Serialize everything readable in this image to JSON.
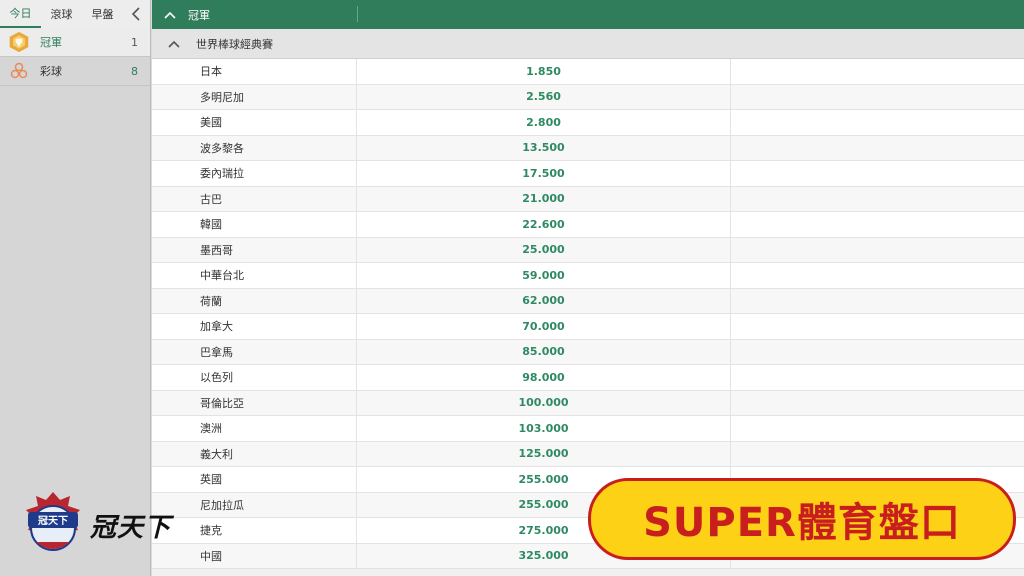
{
  "sidebar": {
    "tabs": [
      {
        "label": "今日"
      },
      {
        "label": "滾球"
      },
      {
        "label": "早盤"
      }
    ],
    "collapse_icon": "chevron-left-icon",
    "items": [
      {
        "label": "冠軍",
        "count": "1",
        "icon": "trophy-icon"
      },
      {
        "label": "彩球",
        "count": "8",
        "icon": "lottery-balls-icon"
      }
    ]
  },
  "header": {
    "title": "冠軍",
    "collapse_icon": "chevron-up-icon"
  },
  "league": {
    "name": "世界棒球經典賽"
  },
  "rows": [
    {
      "team": "日本",
      "odds": "1.850"
    },
    {
      "team": "多明尼加",
      "odds": "2.560"
    },
    {
      "team": "美國",
      "odds": "2.800"
    },
    {
      "team": "波多黎各",
      "odds": "13.500"
    },
    {
      "team": "委內瑞拉",
      "odds": "17.500"
    },
    {
      "team": "古巴",
      "odds": "21.000"
    },
    {
      "team": "韓國",
      "odds": "22.600"
    },
    {
      "team": "墨西哥",
      "odds": "25.000"
    },
    {
      "team": "中華台北",
      "odds": "59.000"
    },
    {
      "team": "荷蘭",
      "odds": "62.000"
    },
    {
      "team": "加拿大",
      "odds": "70.000"
    },
    {
      "team": "巴拿馬",
      "odds": "85.000"
    },
    {
      "team": "以色列",
      "odds": "98.000"
    },
    {
      "team": "哥倫比亞",
      "odds": "100.000"
    },
    {
      "team": "澳洲",
      "odds": "103.000"
    },
    {
      "team": "義大利",
      "odds": "125.000"
    },
    {
      "team": "英國",
      "odds": "255.000"
    },
    {
      "team": "尼加拉瓜",
      "odds": "255.000"
    },
    {
      "team": "捷克",
      "odds": "275.000"
    },
    {
      "team": "中國",
      "odds": "325.000"
    }
  ],
  "overlay": {
    "logo_badge_text": "冠天下",
    "logo_text": "冠天下",
    "banner_text": "SUPER體育盤口"
  },
  "colors": {
    "accent": "#2f7d5b",
    "odds": "#2f8a63",
    "banner_bg": "#fcd116",
    "banner_fg": "#c81e1e"
  }
}
